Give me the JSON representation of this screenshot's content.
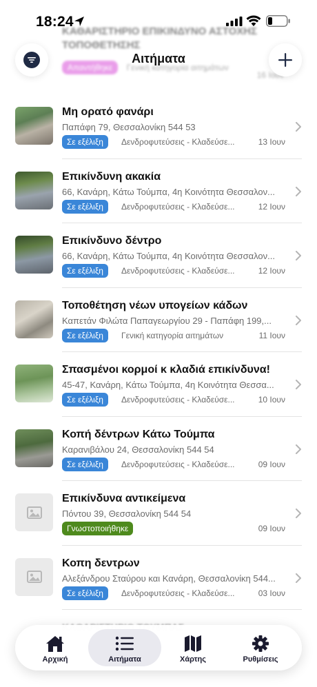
{
  "status_bar": {
    "time": "18:24"
  },
  "header": {
    "title": "Αιτήματα",
    "filter_icon": "filter-icon",
    "add_icon": "plus-icon"
  },
  "ghost_row": {
    "title": "ΚΑΘΑΡΙΣΤΗΡΙΟ ΕΠΙΚΙΝΔΥΝΟ ΑΣΤΟΧΗΣ ΤΟΠΟΘΕΤΗΣΗΣ",
    "badge": "Απαντήθηκε",
    "category": "Γενική κατηγορία αιτημάτων",
    "date": "16 Ιουν"
  },
  "requests": [
    {
      "title": "Μη ορατό φανάρι",
      "address": "Παπάφη 79, Θεσσαλονίκη 544 53",
      "status": "Σε εξέλιξη",
      "status_color": "#3a86d8",
      "category": "Δενδροφυτεύσεις - Κλαδεύσε...",
      "date": "13 Ιουν",
      "thumb": "photo"
    },
    {
      "title": "Επικίνδυνη ακακία",
      "address": "66, Κανάρη, Κάτω Τούμπα, 4η Κοινότητα Θεσσαλον...",
      "status": "Σε εξέλιξη",
      "status_color": "#3a86d8",
      "category": "Δενδροφυτεύσεις - Κλαδεύσε...",
      "date": "12 Ιουν",
      "thumb": "photo"
    },
    {
      "title": "Επικίνδυνο δέντρο",
      "address": "66, Κανάρη, Κάτω Τούμπα, 4η Κοινότητα Θεσσαλον...",
      "status": "Σε εξέλιξη",
      "status_color": "#3a86d8",
      "category": "Δενδροφυτεύσεις - Κλαδεύσε...",
      "date": "12 Ιουν",
      "thumb": "photo"
    },
    {
      "title": "Τοποθέτηση νέων υπογείων κάδων",
      "address": "Καπετάν Φιλώτα Παπαγεωργίου 29 - Παπάφη 199,...",
      "status": "Σε εξέλιξη",
      "status_color": "#3a86d8",
      "category": "Γενική κατηγορία αιτημάτων",
      "date": "11 Ιουν",
      "thumb": "photo"
    },
    {
      "title": "Σπασμένοι κορμοί κ κλαδιά επικίνδυνα!",
      "address": "45-47, Κανάρη, Κάτω Τούμπα, 4η Κοινότητα Θεσσα...",
      "status": "Σε εξέλιξη",
      "status_color": "#3a86d8",
      "category": "Δενδροφυτεύσεις - Κλαδεύσε...",
      "date": "10 Ιουν",
      "thumb": "photo"
    },
    {
      "title": "Κοπή δέντρων Κάτω Τούμπα",
      "address": "Καρανιβάλου 24, Θεσσαλονίκη 544 54",
      "status": "Σε εξέλιξη",
      "status_color": "#3a86d8",
      "category": "Δενδροφυτεύσεις - Κλαδεύσε...",
      "date": "09 Ιουν",
      "thumb": "photo"
    },
    {
      "title": "Επικίνδυνα αντικείμενα",
      "address": "Πόντου 39, Θεσσαλονίκη 544 54",
      "status": "Γνωστοποιήθηκε",
      "status_color": "#4e8a1d",
      "category": "",
      "date": "09 Ιουν",
      "thumb": "placeholder"
    },
    {
      "title": "Κοπη δεντρων",
      "address": "Αλεξάνδρου Σταύρου και Κανάρη, Θεσσαλονίκη 544...",
      "status": "Σε εξέλιξη",
      "status_color": "#3a86d8",
      "category": "Δενδροφυτεύσεις - Κλαδεύσε...",
      "date": "03 Ιουν",
      "thumb": "placeholder"
    }
  ],
  "ghost_bottom": "ΚΑΘΑΡΙΣΤΗΡΙΟ ΤΟΥΜΠΑΣ",
  "tabs": [
    {
      "label": "Αρχική",
      "icon": "home-icon",
      "active": false
    },
    {
      "label": "Αιτήματα",
      "icon": "list-icon",
      "active": true
    },
    {
      "label": "Χάρτης",
      "icon": "map-icon",
      "active": false
    },
    {
      "label": "Ρυθμίσεις",
      "icon": "gear-icon",
      "active": false
    }
  ]
}
